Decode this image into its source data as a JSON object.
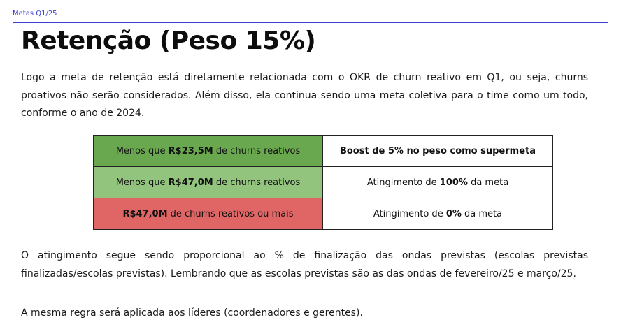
{
  "header": {
    "label": "Metas Q1/25"
  },
  "title": "Retenção (Peso 15%)",
  "paragraphs": {
    "intro": "Logo a meta de retenção está diretamente relacionada com o OKR de churn reativo em Q1, ou seja, churns proativos não serão considerados. Além disso, ela continua sendo uma meta coletiva para o time como um todo, conforme o ano de 2024.",
    "proportional": "O atingimento segue sendo proporcional ao % de finalização das ondas previstas (escolas previstas finalizadas/escolas previstas). Lembrando que as escolas previstas são as das ondas de fevereiro/25 e março/25.",
    "leaders": "A mesma regra será aplicada aos líderes (coordenadores e gerentes)."
  },
  "table": {
    "rows": [
      {
        "color": "#6aa84f",
        "condition": {
          "pre": "Menos que ",
          "value": "R$23,5M",
          "post": " de churns reativos"
        },
        "result": {
          "pre": "",
          "value": "Boost de 5% no peso como supermeta",
          "post": ""
        }
      },
      {
        "color": "#93c47d",
        "condition": {
          "pre": "Menos que ",
          "value": "R$47,0M",
          "post": " de churns reativos"
        },
        "result": {
          "pre": "Atingimento de ",
          "value": "100%",
          "post": " da meta"
        }
      },
      {
        "color": "#e06666",
        "condition": {
          "pre": "",
          "value": "R$47,0M",
          "post": " de churns reativos ou mais"
        },
        "result": {
          "pre": "Atingimento de ",
          "value": "0%",
          "post": " da meta"
        }
      }
    ]
  }
}
